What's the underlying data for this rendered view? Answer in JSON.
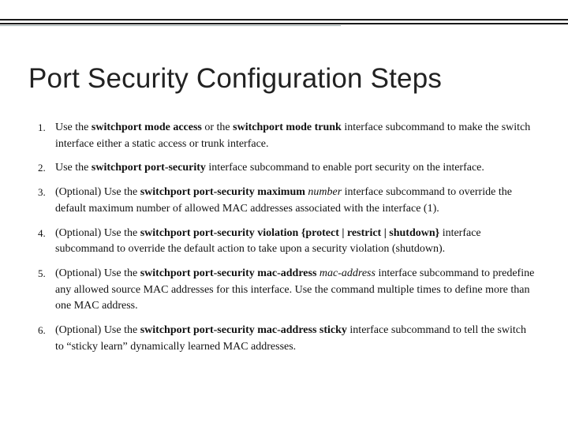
{
  "title": "Port Security Configuration Steps",
  "items": [
    {
      "prefix": "Use the ",
      "b1": "switchport mode access",
      "mid1": " or the ",
      "b2": "switchport mode trunk",
      "tail": " interface subcommand to make the switch interface either a static access or trunk interface."
    },
    {
      "prefix": "Use the ",
      "b1": "switchport port-security",
      "tail": " interface subcommand to enable port security on the interface."
    },
    {
      "prefix": "(Optional) Use the ",
      "b1": "switchport port-security maximum",
      "i1": " number",
      "tail": " interface subcommand to override the default maximum number of allowed MAC addresses associated with the interface (1)."
    },
    {
      "prefix": "(Optional) Use the ",
      "b1": "switchport port-security violation {protect | restrict | shutdown}",
      "tail": " interface subcommand to override the default action to take upon a security violation (shutdown)."
    },
    {
      "prefix": "(Optional) Use the ",
      "b1": "switchport port-security mac-address",
      "i1": " mac-address",
      "tail": " interface subcommand to predefine any allowed source MAC addresses for this interface. Use the command multiple times to define more than one MAC address."
    },
    {
      "prefix": "(Optional) Use the ",
      "b1": "switchport port-security mac-address sticky",
      "tail": " interface subcommand to tell the switch to “sticky learn” dynamically learned MAC addresses."
    }
  ]
}
